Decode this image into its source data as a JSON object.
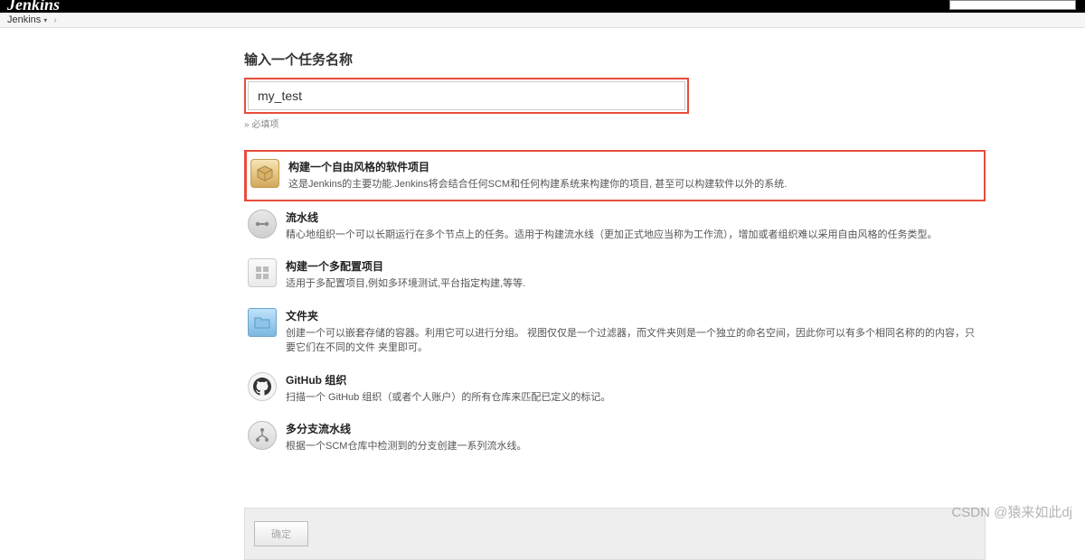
{
  "header": {
    "logo_text": "Jenkins"
  },
  "breadcrumb": {
    "root": "Jenkins"
  },
  "form": {
    "title": "输入一个任务名称",
    "name_value": "my_test",
    "required_hint": "» 必填项"
  },
  "items": [
    {
      "title": "构建一个自由风格的软件项目",
      "desc": "这是Jenkins的主要功能.Jenkins将会结合任何SCM和任何构建系统来构建你的项目, 甚至可以构建软件以外的系统.",
      "highlighted": true
    },
    {
      "title": "流水线",
      "desc": "精心地组织一个可以长期运行在多个节点上的任务。适用于构建流水线（更加正式地应当称为工作流），增加或者组织难以采用自由风格的任务类型。"
    },
    {
      "title": "构建一个多配置项目",
      "desc": "适用于多配置项目,例如多环境测试,平台指定构建,等等."
    },
    {
      "title": "文件夹",
      "desc": "创建一个可以嵌套存储的容器。利用它可以进行分组。 视图仅仅是一个过滤器，而文件夹则是一个独立的命名空间，因此你可以有多个相同名称的的内容，只要它们在不同的文件 夹里即可。"
    },
    {
      "title": "GitHub 组织",
      "desc": "扫描一个 GitHub 组织（或者个人账户）的所有仓库来匹配已定义的标记。"
    },
    {
      "title": "多分支流水线",
      "desc": "根据一个SCM仓库中检测到的分支创建一系列流水线。"
    }
  ],
  "footer": {
    "ok_label": "确定"
  },
  "watermark": "CSDN @猿来如此dj"
}
